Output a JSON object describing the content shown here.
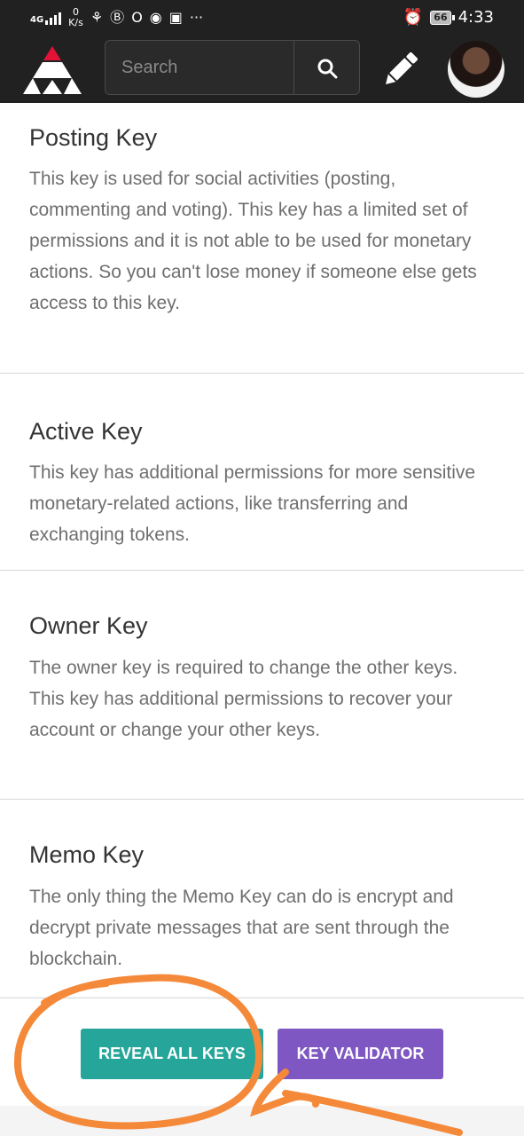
{
  "status_bar": {
    "network": "4G",
    "speed_value": "0",
    "speed_unit": "K/s",
    "notification_icons": [
      "snapchat-icon",
      "b-circle-icon",
      "opera-icon",
      "discord-icon",
      "instagram-icon"
    ],
    "more": "···",
    "battery": "66",
    "time": "4:33"
  },
  "header": {
    "search_placeholder": "Search",
    "icons": [
      "logo-icon",
      "search-icon",
      "pencil-icon",
      "avatar"
    ]
  },
  "sections": [
    {
      "title": "Posting Key",
      "description": "This key is used for social activities (posting, commenting and voting). This key has a limited set of permissions and it is not able to be used for monetary actions. So you can't lose money if someone else gets access to this key."
    },
    {
      "title": "Active Key",
      "description": "This key has additional permissions for more sensitive monetary-related actions, like transferring and exchanging tokens."
    },
    {
      "title": "Owner Key",
      "description": "The owner key is required to change the other keys. This key has additional permissions to recover your account or change your other keys."
    },
    {
      "title": "Memo Key",
      "description": "The only thing the Memo Key can do is encrypt and decrypt private messages that are sent through the blockchain."
    }
  ],
  "buttons": {
    "reveal_all_keys": "REVEAL ALL KEYS",
    "key_validator": "KEY VALIDATOR"
  },
  "colors": {
    "header_bg": "#212121",
    "reveal_button": "#26a69a",
    "validator_button": "#7e57c2",
    "annotation": "#f5893a",
    "logo_accent": "#e31337"
  }
}
